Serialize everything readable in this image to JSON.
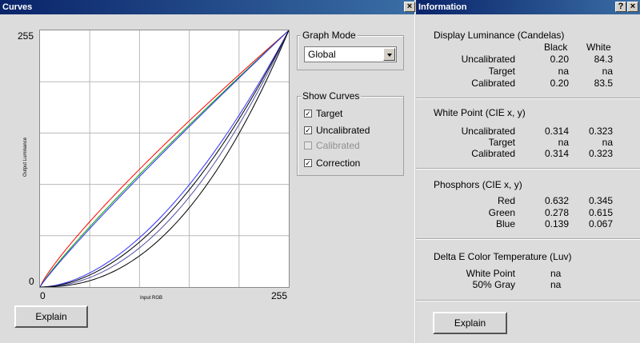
{
  "curves_window": {
    "title": "Curves",
    "close_glyph": "×",
    "graph": {
      "y_top_label": "255",
      "y_bottom_label": "0",
      "x_left_label": "0",
      "x_right_label": "255",
      "ylabel": "Output Luminance",
      "xlabel": "Input RGB",
      "series_colors": {
        "target_red": "#ff0000",
        "target_green": "#00a000",
        "target_blue": "#3030ff",
        "correction": "#000000"
      }
    },
    "explain_label": "Explain",
    "graph_mode": {
      "title": "Graph Mode",
      "selected": "Global"
    },
    "show_curves": {
      "title": "Show Curves",
      "items": [
        {
          "label": "Target",
          "checked": true,
          "enabled": true
        },
        {
          "label": "Uncalibrated",
          "checked": true,
          "enabled": true
        },
        {
          "label": "Calibrated",
          "checked": false,
          "enabled": false
        },
        {
          "label": "Correction",
          "checked": true,
          "enabled": true
        }
      ]
    }
  },
  "information_window": {
    "title": "Information",
    "help_glyph": "?",
    "close_glyph": "×",
    "luminance": {
      "title": "Display Luminance (Candelas)",
      "col_black": "Black",
      "col_white": "White",
      "rows": [
        {
          "label": "Uncalibrated",
          "a": "0.20",
          "b": "84.3"
        },
        {
          "label": "Target",
          "a": "na",
          "b": "na"
        },
        {
          "label": "Calibrated",
          "a": "0.20",
          "b": "83.5"
        }
      ]
    },
    "white_point": {
      "title": "White Point (CIE x, y)",
      "rows": [
        {
          "label": "Uncalibrated",
          "a": "0.314",
          "b": "0.323"
        },
        {
          "label": "Target",
          "a": "na",
          "b": "na"
        },
        {
          "label": "Calibrated",
          "a": "0.314",
          "b": "0.323"
        }
      ]
    },
    "phosphors": {
      "title": "Phosphors (CIE x, y)",
      "rows": [
        {
          "label": "Red",
          "a": "0.632",
          "b": "0.345"
        },
        {
          "label": "Green",
          "a": "0.278",
          "b": "0.615"
        },
        {
          "label": "Blue",
          "a": "0.139",
          "b": "0.067"
        }
      ]
    },
    "delta_e": {
      "title": "Delta E Color Temperature (Luv)",
      "rows": [
        {
          "label": "White Point",
          "a": "na"
        },
        {
          "label": "50% Gray",
          "a": "na"
        }
      ]
    },
    "explain_label": "Explain"
  }
}
